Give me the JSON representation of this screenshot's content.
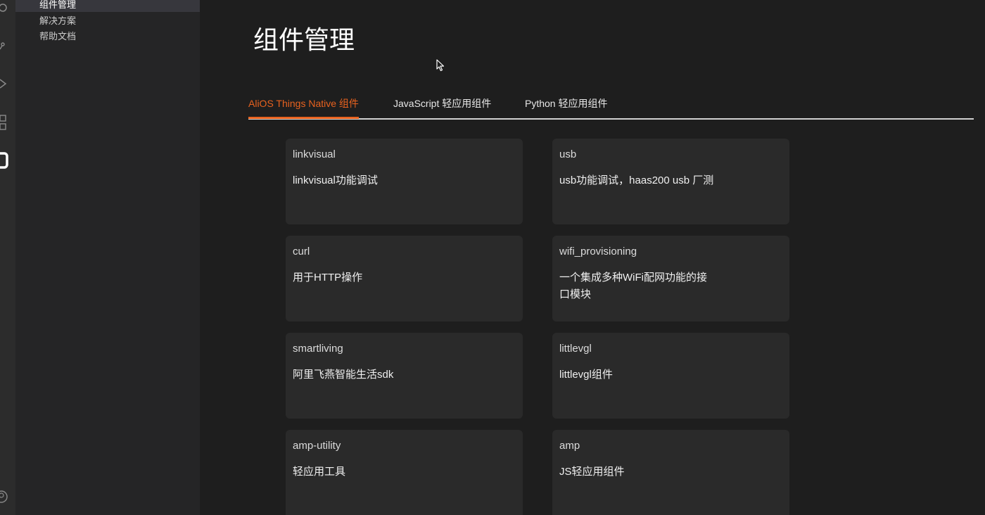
{
  "sidebar": {
    "items": [
      {
        "label": "组件管理",
        "active": true
      },
      {
        "label": "解决方案",
        "active": false
      },
      {
        "label": "帮助文档",
        "active": false
      }
    ]
  },
  "activity_icons": [
    "search-icon",
    "git-icon",
    "run-icon",
    "extensions-icon",
    "haas-icon",
    "account-icon"
  ],
  "page": {
    "title": "组件管理"
  },
  "tabs": [
    {
      "label": "AliOS Things Native 组件",
      "active": true
    },
    {
      "label": "JavaScript 轻应用组件",
      "active": false
    },
    {
      "label": "Python 轻应用组件",
      "active": false
    }
  ],
  "components": [
    {
      "name": "linkvisual",
      "description": "linkvisual功能调试"
    },
    {
      "name": "usb",
      "description": "usb功能调试，haas200 usb 厂测"
    },
    {
      "name": "curl",
      "description": "用于HTTP操作"
    },
    {
      "name": "wifi_provisioning",
      "description": "一个集成多种WiFi配网功能的接口模块"
    },
    {
      "name": "smartliving",
      "description": "阿里飞燕智能生活sdk"
    },
    {
      "name": "littlevgl",
      "description": "littlevgl组件"
    },
    {
      "name": "amp-utility",
      "description": "轻应用工具"
    },
    {
      "name": "amp",
      "description": "JS轻应用组件"
    }
  ],
  "colors": {
    "accent": "#e8621f",
    "background": "#1e1e1e",
    "sidebar": "#252526",
    "card": "#2a2a2a"
  }
}
